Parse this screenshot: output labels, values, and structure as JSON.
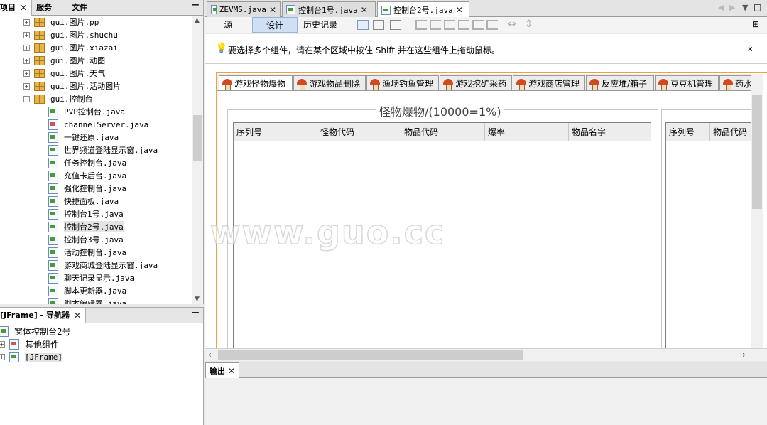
{
  "left_panel": {
    "tabs": [
      {
        "label": "项目"
      },
      {
        "label": "服务"
      },
      {
        "label": "文件"
      }
    ],
    "minimize": "—",
    "tree": [
      {
        "label": "gui.图片.pp",
        "type": "package"
      },
      {
        "label": "gui.图片.shuchu",
        "type": "package"
      },
      {
        "label": "gui.图片.xiazai",
        "type": "package"
      },
      {
        "label": "gui.图片.动图",
        "type": "package"
      },
      {
        "label": "gui.图片.天气",
        "type": "package"
      },
      {
        "label": "gui.图片.活动图片",
        "type": "package"
      },
      {
        "label": "gui.控制台",
        "type": "package-open"
      },
      {
        "label": "PVP控制台.java",
        "type": "form"
      },
      {
        "label": "channelServer.java",
        "type": "class"
      },
      {
        "label": "一键还原.java",
        "type": "form"
      },
      {
        "label": "世界频道登陆显示窗.java",
        "type": "form"
      },
      {
        "label": "任务控制台.java",
        "type": "form"
      },
      {
        "label": "充值卡后台.java",
        "type": "form"
      },
      {
        "label": "强化控制台.java",
        "type": "form"
      },
      {
        "label": "快捷面板.java",
        "type": "form"
      },
      {
        "label": "控制台1号.java",
        "type": "form"
      },
      {
        "label": "控制台2号.java",
        "type": "form",
        "selected": true
      },
      {
        "label": "控制台3号.java",
        "type": "form"
      },
      {
        "label": "活动控制台.java",
        "type": "form"
      },
      {
        "label": "游戏商城登陆显示窗.java",
        "type": "form"
      },
      {
        "label": "聊天记录显示.java",
        "type": "form"
      },
      {
        "label": "脚本更新器.java",
        "type": "form"
      },
      {
        "label": "脚本编辑器.java",
        "type": "form"
      }
    ]
  },
  "navigator": {
    "title": "[JFrame] - 导航器",
    "items": [
      {
        "label": "窗体控制台2号"
      },
      {
        "label": "其他组件"
      },
      {
        "label": "[JFrame]"
      }
    ]
  },
  "editor": {
    "tabs": [
      {
        "label": "ZEVMS.java"
      },
      {
        "label": "控制台1号.java"
      },
      {
        "label": "控制台2号.java",
        "active": true
      }
    ],
    "toolbar": {
      "source": "源",
      "design": "设计",
      "history": "历史记录"
    },
    "hint": "要选择多个组件，请在某个区域中按住 Shift 并在这些组件上拖动鼠标。",
    "hint_close": "x"
  },
  "form": {
    "tabs": [
      {
        "label": "游戏怪物爆物",
        "active": true
      },
      {
        "label": "游戏物品删除"
      },
      {
        "label": "渔场钓鱼管理"
      },
      {
        "label": "游戏挖矿采药"
      },
      {
        "label": "游戏商店管理"
      },
      {
        "label": "反应堆/箱子"
      },
      {
        "label": "豆豆机管理"
      },
      {
        "label": "药水"
      }
    ],
    "group_title": "怪物爆物/(10000=1%)",
    "table_headers": [
      "序列号",
      "怪物代码",
      "物品代码",
      "爆率",
      "物品名字"
    ],
    "table2_headers": [
      "序列号",
      "物品代码"
    ],
    "watermark": "www.guo.cc"
  },
  "output": {
    "tab": "输出"
  }
}
